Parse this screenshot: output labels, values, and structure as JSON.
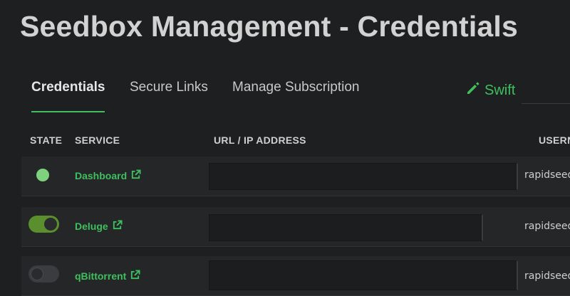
{
  "page": {
    "title": "Seedbox Management - Credentials"
  },
  "tabs": [
    {
      "label": "Credentials",
      "active": true
    },
    {
      "label": "Secure Links",
      "active": false
    },
    {
      "label": "Manage Subscription",
      "active": false
    }
  ],
  "swift": {
    "label": "Swift",
    "icon": "pencil-icon"
  },
  "columns": {
    "state": "STATE",
    "service": "SERVICE",
    "url": "URL / IP ADDRESS",
    "username": "USERN"
  },
  "rows": [
    {
      "service": "Dashboard",
      "state": "status-dot",
      "url": "",
      "username": "rapidseed"
    },
    {
      "service": "Deluge",
      "state": "on",
      "url": "",
      "username": "rapidseed"
    },
    {
      "service": "qBittorrent",
      "state": "off",
      "url": "",
      "username": "rapidseed"
    }
  ],
  "colors": {
    "accent": "#3fbf5e",
    "toggle_on": "#5b8f2e",
    "status_dot": "#7ed27e",
    "background": "#1e1f21"
  }
}
